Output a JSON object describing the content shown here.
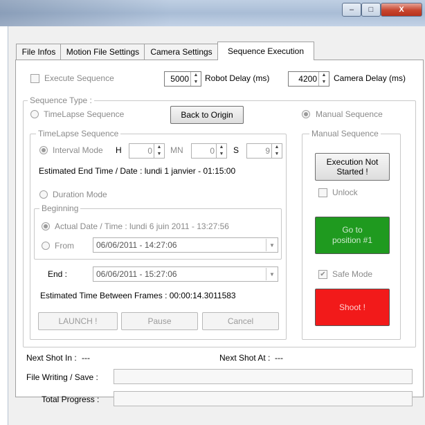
{
  "window": {
    "minimize_glyph": "–",
    "maximize_glyph": "□",
    "close_glyph": "X"
  },
  "tabs": [
    {
      "label": "File Infos"
    },
    {
      "label": "Motion File Settings"
    },
    {
      "label": "Camera Settings"
    },
    {
      "label": "Sequence Execution",
      "active": true
    }
  ],
  "top": {
    "execute_sequence_label": "Execute Sequence",
    "execute_sequence_checked": false,
    "robot_delay_value": "5000",
    "robot_delay_label": "Robot Delay (ms)",
    "camera_delay_value": "4200",
    "camera_delay_label": "Camera Delay (ms)"
  },
  "sequence_type": {
    "legend": "Sequence Type :",
    "timelapse_radio_label": "TimeLapse Sequence",
    "back_to_origin_label": "Back to Origin",
    "manual_radio_label": "Manual Sequence",
    "selected": "manual"
  },
  "timelapse": {
    "legend": "TimeLapse Sequence",
    "interval_mode_label": "Interval Mode",
    "h_label": "H",
    "h_value": "0",
    "mn_label": "MN",
    "mn_value": "0",
    "s_label": "S",
    "s_value": "9",
    "estimated_end_text": "Estimated End Time / Date : lundi 1 janvier - 01:15:00",
    "duration_mode_label": "Duration Mode",
    "beginning_legend": "Beginning",
    "actual_date_text": "Actual Date / Time : lundi 6 juin 2011 - 13:27:56",
    "from_label": "From",
    "from_value": "06/06/2011 - 14:27:06",
    "end_label": "End :",
    "end_value": "06/06/2011 - 15:27:06",
    "estimated_between_text": "Estimated Time Between Frames : 00:00:14.3011583",
    "launch_label": "LAUNCH !",
    "pause_label": "Pause",
    "cancel_label": "Cancel"
  },
  "manual": {
    "legend": "Manual Sequence",
    "execution_status_label": "Execution Not Started !",
    "unlock_label": "Unlock",
    "goto_label": "Go to position #1",
    "safe_mode_label": "Safe Mode",
    "safe_mode_checked": true,
    "shoot_label": "Shoot !",
    "goto_color": "#1f9a1f",
    "shoot_color": "#f21a1a"
  },
  "status": {
    "next_shot_in_label": "Next Shot In :",
    "next_shot_in_value": "---",
    "next_shot_at_label": "Next Shot At :",
    "next_shot_at_value": "---",
    "file_writing_label": "File Writing / Save :",
    "total_progress_label": "Total Progress  :"
  }
}
